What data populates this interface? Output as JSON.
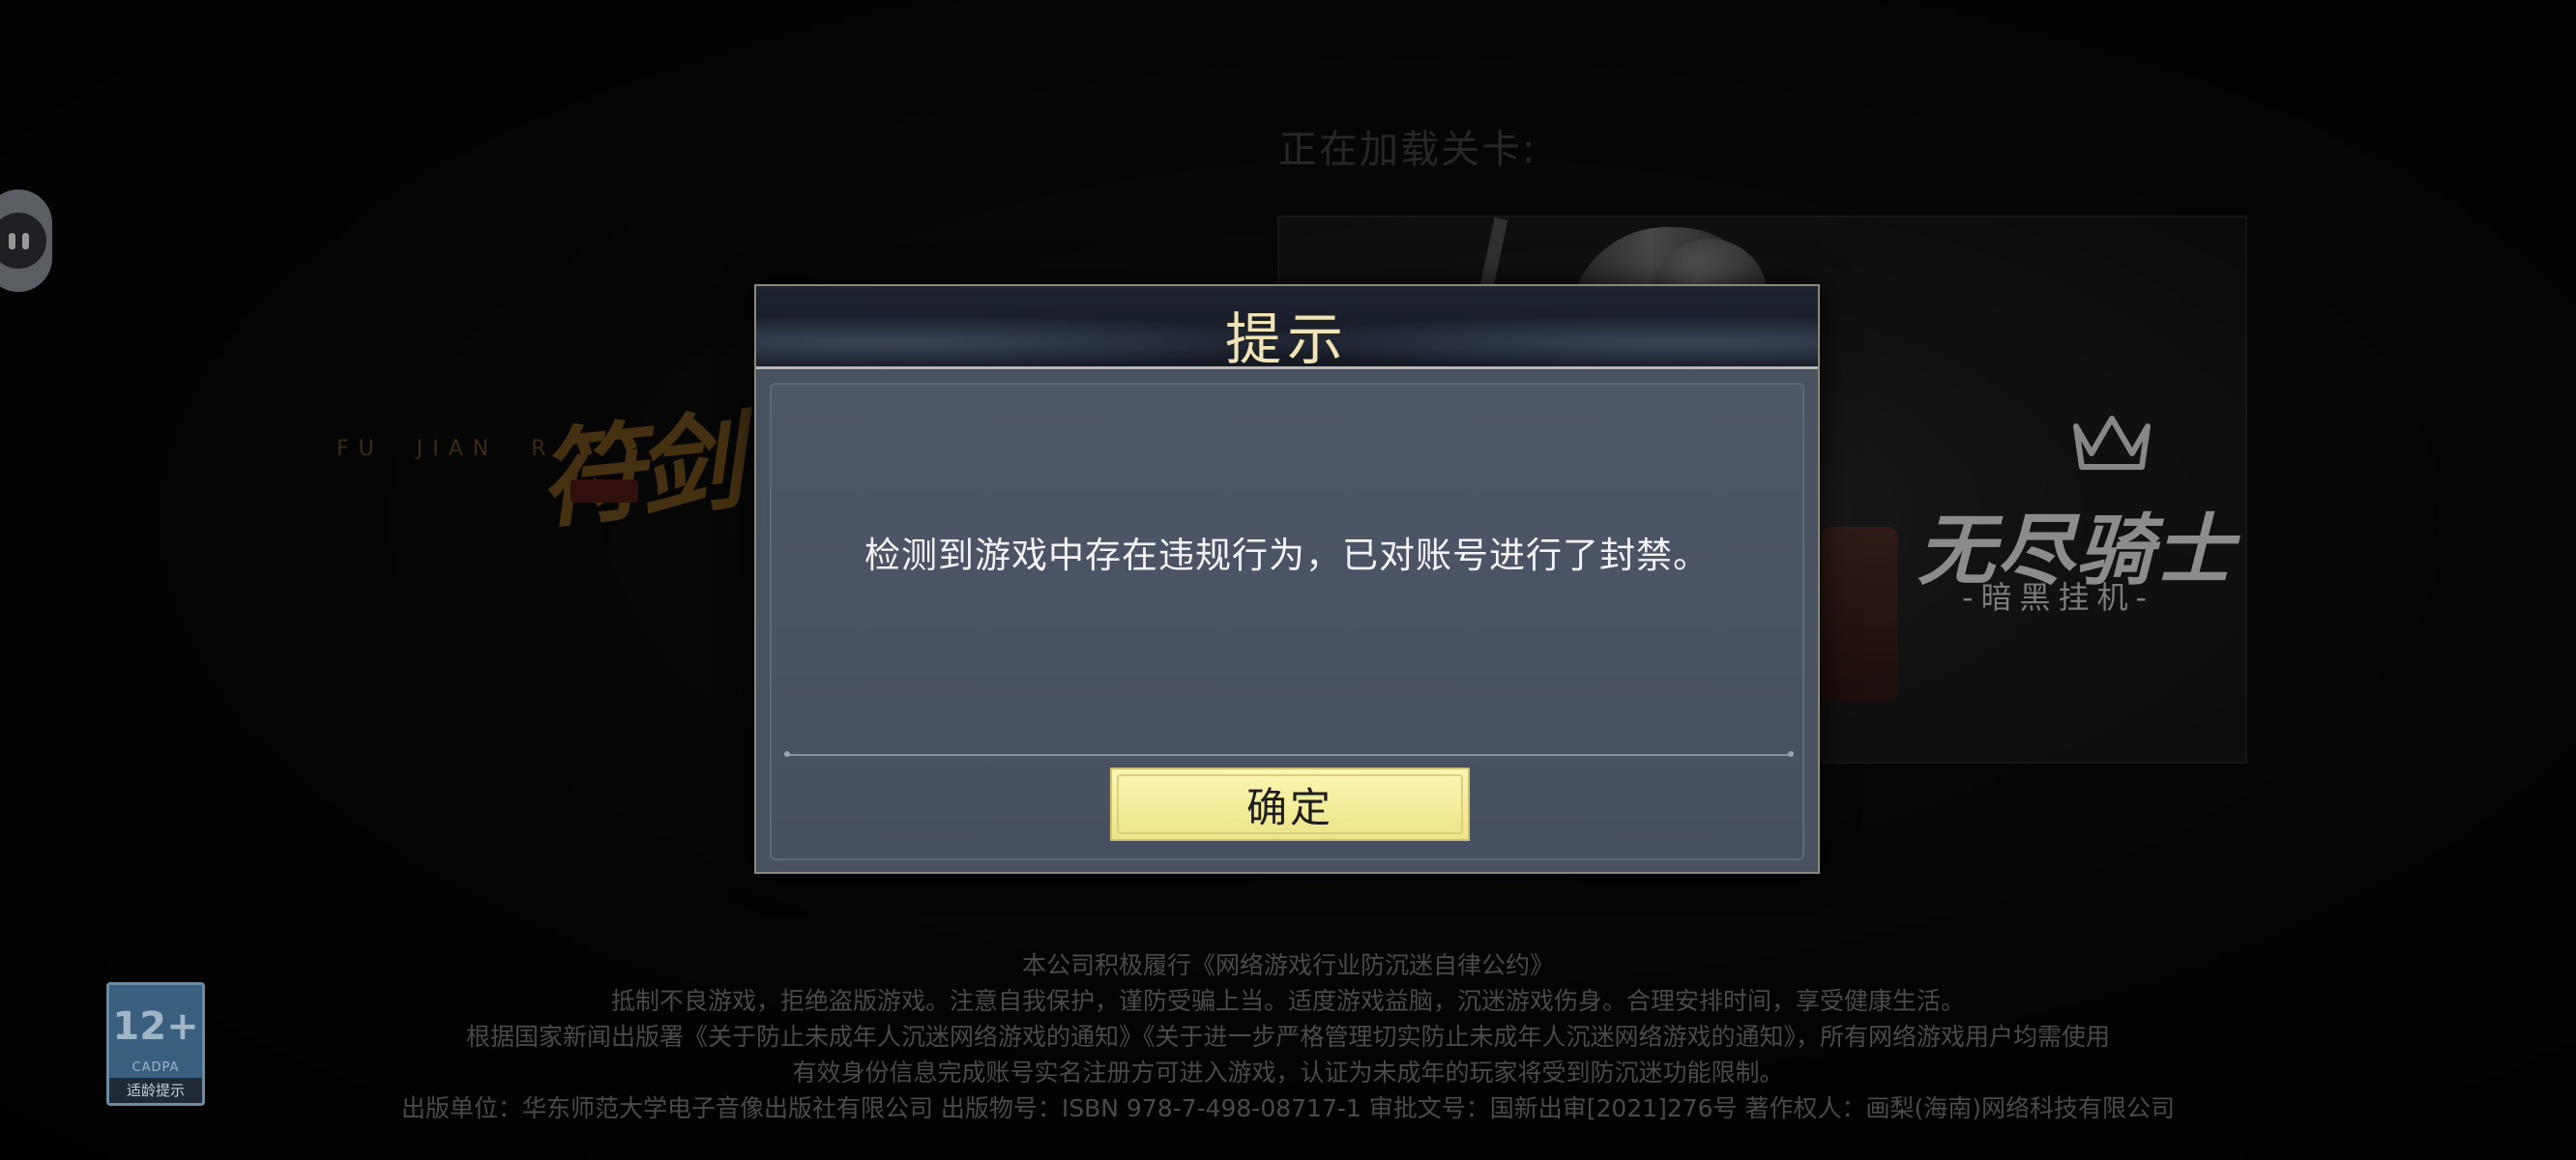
{
  "loading": {
    "label": "正在加载关卡:"
  },
  "game_logo": {
    "english": "FU  JIAN  R",
    "chinese": "符剑"
  },
  "level_image": {
    "brand_title": "无尽骑士",
    "brand_subtitle": "-暗黑挂机-"
  },
  "dialog": {
    "title": "提示",
    "message": "检测到游戏中存在违规行为，已对账号进行了封禁。",
    "confirm_label": "确定"
  },
  "age_badge": {
    "rating": "12+",
    "org": "CADPA",
    "tip": "适龄提示"
  },
  "footer": {
    "lines": [
      "本公司积极履行《网络游戏行业防沉迷自律公约》",
      "抵制不良游戏，拒绝盗版游戏。注意自我保护，谨防受骗上当。适度游戏益脑，沉迷游戏伤身。合理安排时间，享受健康生活。",
      "根据国家新闻出版署《关于防止未成年人沉迷网络游戏的通知》《关于进一步严格管理切实防止未成年人沉迷网络游戏的通知》，所有网络游戏用户均需使用",
      "有效身份信息完成账号实名注册方可进入游戏，认证为未成年的玩家将受到防沉迷功能限制。",
      "出版单位：华东师范大学电子音像出版社有限公司   出版物号：ISBN 978-7-498-08717-1   审批文号：国新出审[2021]276号   著作权人：画梨(海南)网络科技有限公司"
    ]
  },
  "colors": {
    "dialog_title": "#f1e3b5",
    "confirm_button": "#f5ee9e",
    "dialog_body": "#495260"
  },
  "icons": {
    "assist_bubble": "pause-bubble-icon",
    "crown": "crown-icon"
  }
}
